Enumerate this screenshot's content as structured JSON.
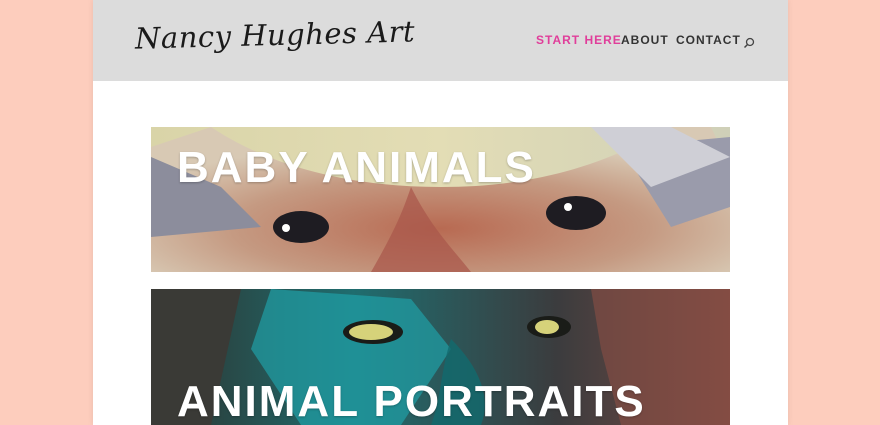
{
  "site": {
    "logo": "Nancy Hughes Art"
  },
  "nav": {
    "items": [
      {
        "label": "START HERE",
        "active": true
      },
      {
        "label": "ABOUT",
        "active": false
      },
      {
        "label": "CONTACT",
        "active": false
      }
    ],
    "search_icon": "search-icon"
  },
  "tiles": [
    {
      "title": "BABY ANIMALS"
    },
    {
      "title": "ANIMAL PORTRAITS"
    }
  ],
  "colors": {
    "background": "#fdcdbd",
    "header": "#dcdcdc",
    "accent": "#e03e9a",
    "nav_text": "#333333"
  }
}
